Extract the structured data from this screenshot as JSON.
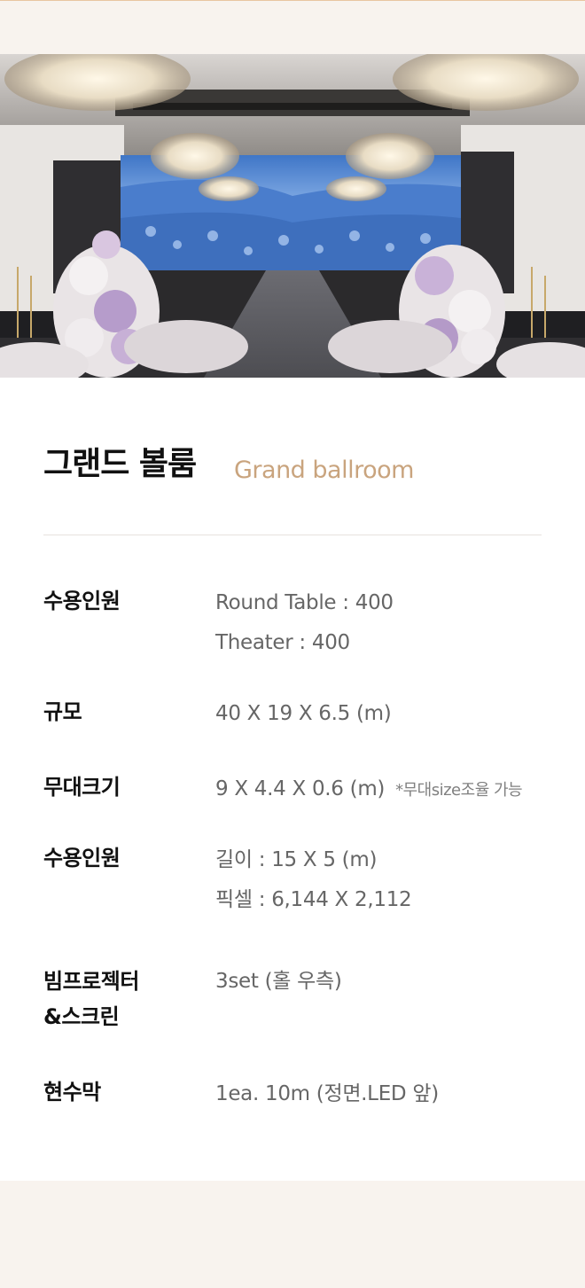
{
  "hero": {
    "image_alt": "grand-ballroom-photo",
    "colors": {
      "led_sky": "#6f9fe0",
      "led_flowers": "#4f7fd0",
      "floor": "#5d5e63",
      "hydrangea_purple": "#b49ac8",
      "hydrangea_white": "#f2eff0"
    }
  },
  "title": {
    "korean": "그랜드 볼룸",
    "english": "Grand ballroom"
  },
  "specs": [
    {
      "label": "수용인원",
      "lines": [
        "Round Table : 400",
        "Theater :  400"
      ],
      "note": ""
    },
    {
      "label": "규모",
      "lines": [
        "40 X 19 X 6.5 (m)"
      ],
      "note": ""
    },
    {
      "label": "무대크기",
      "lines": [
        "9 X 4.4 X 0.6 (m)"
      ],
      "note": "*무대size조율 가능"
    },
    {
      "label": "수용인원",
      "lines": [
        "길이 : 15 X 5 (m)",
        "픽셀 : 6,144 X 2,112"
      ],
      "note": ""
    },
    {
      "label": "빔프로젝터\n&스크린",
      "label_lines": [
        "빔프로젝터",
        "&스크린"
      ],
      "lines": [
        "3set (홀 우측)"
      ],
      "note": ""
    },
    {
      "label": "현수막",
      "lines": [
        "1ea. 10m (정면.LED 앞)"
      ],
      "note": ""
    }
  ],
  "colors": {
    "page_bg": "#f8f3ee",
    "card_bg": "#ffffff",
    "accent": "#c9a47e",
    "label": "#111111",
    "value": "#666666"
  }
}
